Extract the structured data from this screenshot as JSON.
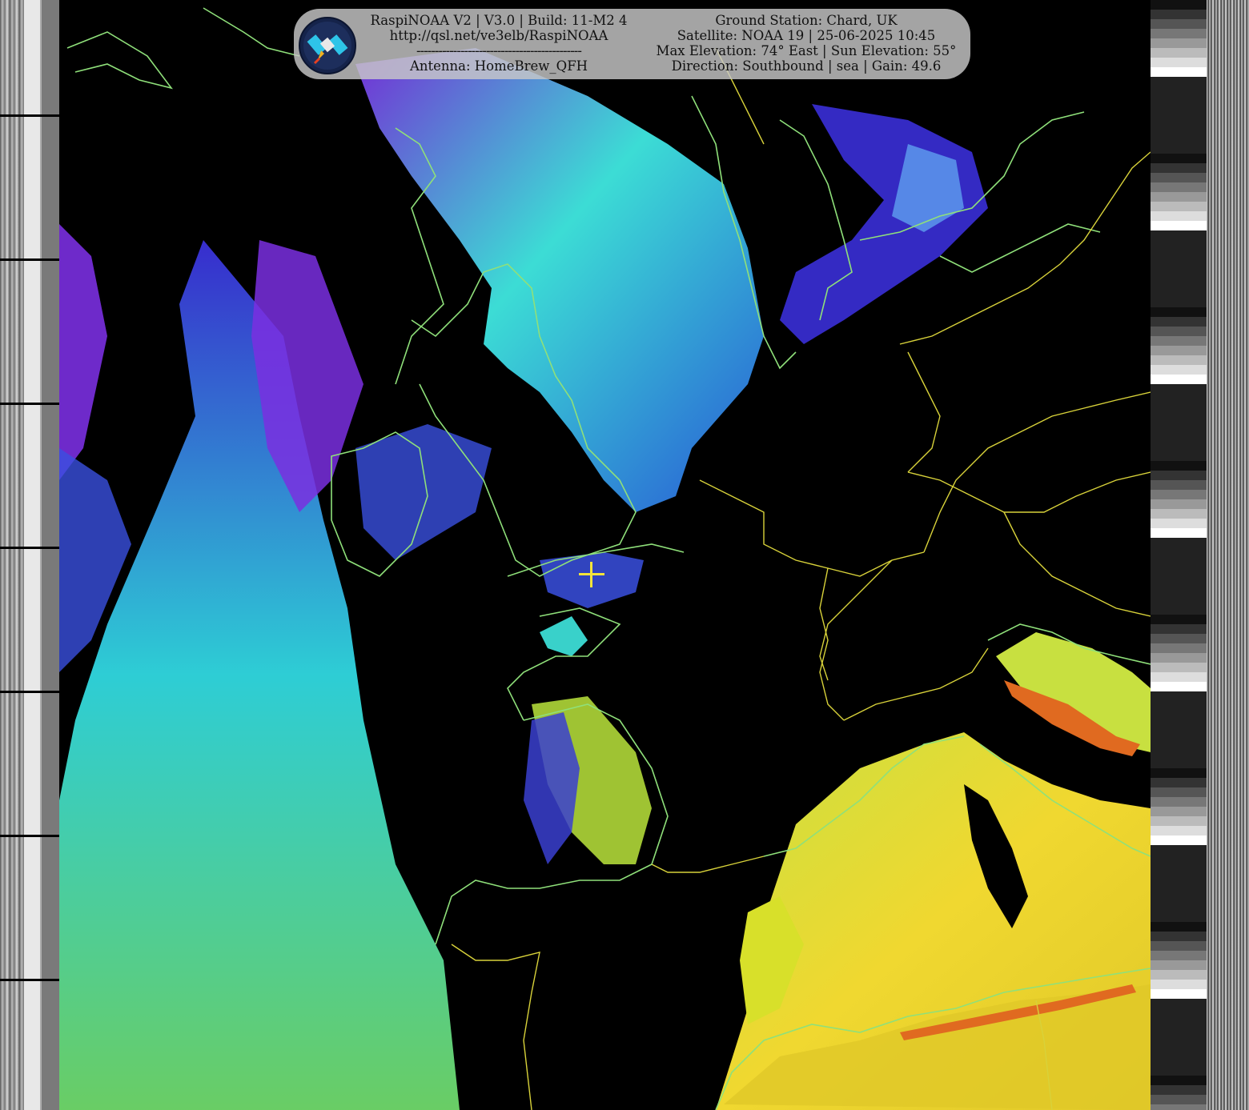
{
  "banner": {
    "left": {
      "line1": "RaspiNOAA V2 | V3.0 | Build: 11-M2 4",
      "line2": "http://qsl.net/ve3elb/RaspiNOAA",
      "line3": "---------------------------------------------",
      "line4": "Antenna: HomeBrew_QFH"
    },
    "right": {
      "line1": "Ground Station: Chard, UK",
      "line2": "Satellite: NOAA 19 | 25-06-2025 10:45",
      "line3": "Max Elevation: 74° East | Sun Elevation: 55°",
      "line4": "Direction: Southbound | sea | Gain: 49.6"
    },
    "logo_icon": "satellite-icon"
  },
  "colors": {
    "crosshair": "#f3e43a",
    "coastline": "#8fe07a",
    "border": "#d8d23a",
    "cloud_cyan": "#3fe8e0",
    "cloud_purple": "#7a2fe0",
    "land_yellow": "#d8e02a"
  }
}
